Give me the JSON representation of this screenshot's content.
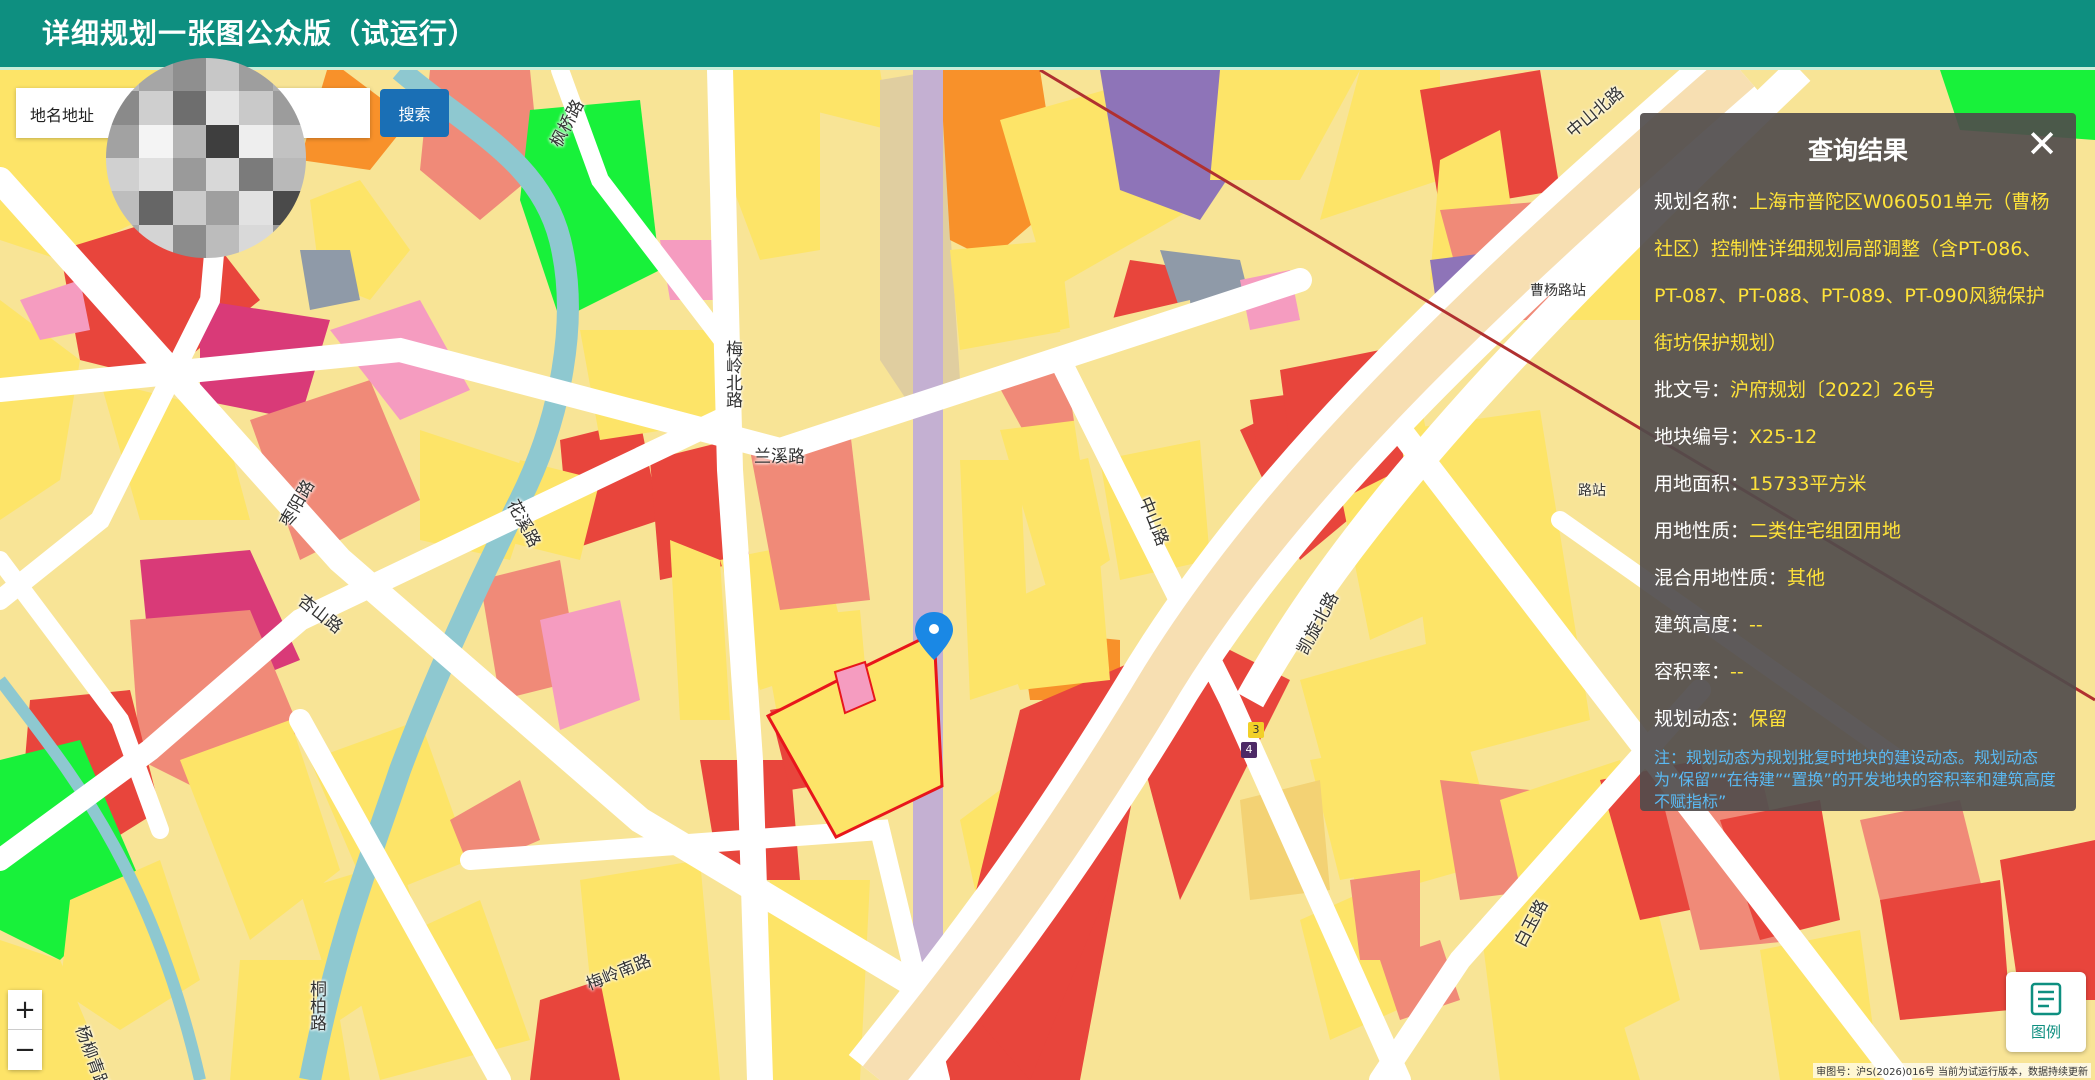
{
  "header": {
    "title": "详细规划一张图公众版（试运行）"
  },
  "search": {
    "type_label": "地名地址",
    "placeholder": "",
    "button": "搜索"
  },
  "roads": [
    {
      "name": "中山北路"
    },
    {
      "name": "兰溪路"
    },
    {
      "name": "梅岭北路"
    },
    {
      "name": "枫桥路"
    },
    {
      "name": "杏山路"
    },
    {
      "name": "花溪路"
    },
    {
      "name": "桐柏路"
    },
    {
      "name": "梅岭南路"
    },
    {
      "name": "杨柳青路"
    },
    {
      "name": "枣阳路"
    },
    {
      "name": "凯旋北路"
    },
    {
      "name": "白玉路"
    },
    {
      "name": "中山路"
    },
    {
      "name": "曹杨路站"
    },
    {
      "name": "路站"
    }
  ],
  "metro_badges": {
    "line3": "3",
    "line4": "4"
  },
  "result_panel": {
    "title": "查询结果",
    "close": "✕",
    "fields": [
      {
        "key": "规划名称：",
        "value": "上海市普陀区W060501单元（曹杨社区）控制性详细规划局部调整（含PT-086、PT-087、PT-088、PT-089、PT-090风貌保护街坊保护规划）"
      },
      {
        "key": "批文号：",
        "value": "沪府规划〔2022〕26号"
      },
      {
        "key": "地块编号：",
        "value": "X25-12"
      },
      {
        "key": "用地面积：",
        "value": "15733平方米"
      },
      {
        "key": "用地性质：",
        "value": "二类住宅组团用地"
      },
      {
        "key": "混合用地性质：",
        "value": "其他"
      },
      {
        "key": "建筑高度：",
        "value": "--"
      },
      {
        "key": "容积率：",
        "value": "--"
      },
      {
        "key": "规划动态：",
        "value": "保留"
      }
    ],
    "note": "注：规划动态为规划批复时地块的建设动态。规划动态为”保留”“在待建”“置换”的开发地块的容积率和建筑高度不赋指标”"
  },
  "zoom": {
    "in": "+",
    "out": "−"
  },
  "legend": {
    "label": "图例"
  },
  "footer": "审图号：沪S(2026)016号 当前为试运行版本，数据持续更新",
  "colors": {
    "header": "#0e8f80",
    "residential": "#fde468",
    "residential_light": "#f8e496",
    "commercial": "#e8453c",
    "public": "#f08a78",
    "green": "#18f13a",
    "orange": "#f8912a",
    "magenta": "#d93a78",
    "pink": "#f59cc0",
    "purple": "#8e74b8",
    "water": "#8ec8d0",
    "road": "#ffffff",
    "selection": "#e8161b",
    "marker": "#1a88e5"
  }
}
